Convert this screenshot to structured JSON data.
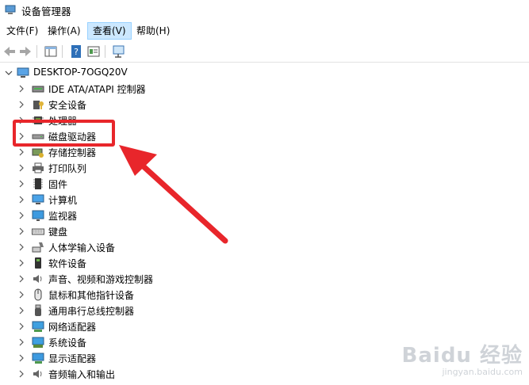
{
  "window": {
    "title": "设备管理器"
  },
  "menu": [
    {
      "label": "文件(F)"
    },
    {
      "label": "操作(A)"
    },
    {
      "label": "查看(V)",
      "active": true
    },
    {
      "label": "帮助(H)"
    }
  ],
  "tree": {
    "root": "DESKTOP-7OGQ20V",
    "items": [
      {
        "label": "IDE ATA/ATAPI 控制器",
        "icon": "ide-controller-icon"
      },
      {
        "label": "安全设备",
        "icon": "security-device-icon"
      },
      {
        "label": "处理器",
        "icon": "processor-icon"
      },
      {
        "label": "磁盘驱动器",
        "icon": "disk-drive-icon"
      },
      {
        "label": "存储控制器",
        "icon": "storage-controller-icon"
      },
      {
        "label": "打印队列",
        "icon": "printer-icon"
      },
      {
        "label": "固件",
        "icon": "firmware-icon"
      },
      {
        "label": "计算机",
        "icon": "computer-icon"
      },
      {
        "label": "监视器",
        "icon": "monitor-icon"
      },
      {
        "label": "键盘",
        "icon": "keyboard-icon"
      },
      {
        "label": "人体学输入设备",
        "icon": "hid-icon"
      },
      {
        "label": "软件设备",
        "icon": "software-device-icon"
      },
      {
        "label": "声音、视频和游戏控制器",
        "icon": "audio-icon"
      },
      {
        "label": "鼠标和其他指针设备",
        "icon": "mouse-icon"
      },
      {
        "label": "通用串行总线控制器",
        "icon": "usb-icon"
      },
      {
        "label": "网络适配器",
        "icon": "network-adapter-icon"
      },
      {
        "label": "系统设备",
        "icon": "system-device-icon"
      },
      {
        "label": "显示适配器",
        "icon": "display-adapter-icon"
      },
      {
        "label": "音频输入和输出",
        "icon": "audio-io-icon"
      }
    ]
  },
  "annotation": {
    "color": "#e8262b",
    "target": "磁盘驱动器"
  },
  "watermark": {
    "logo": "Baidu 经验",
    "url": "jingyan.baidu.com"
  }
}
